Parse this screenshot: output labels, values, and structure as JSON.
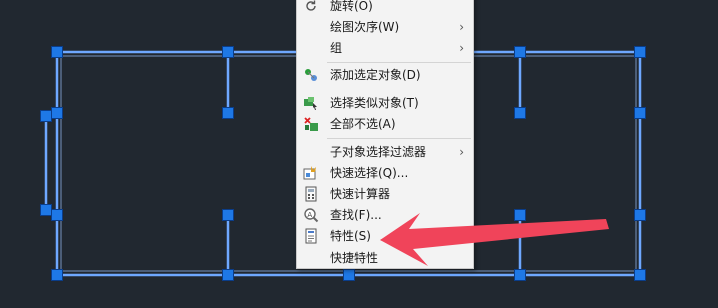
{
  "colors": {
    "background": "#212830",
    "selection_line": "#6fa8ff",
    "grip": "#1e78e6",
    "menu_bg": "#f3f3f3",
    "arrow": "#f0445a"
  },
  "context_menu": {
    "items": [
      {
        "label": "旋转(O)",
        "icon": "rotate-icon",
        "submenu": false
      },
      {
        "label": "绘图次序(W)",
        "icon": "",
        "submenu": true
      },
      {
        "label": "组",
        "icon": "",
        "submenu": true
      },
      {
        "label": "添加选定对象(D)",
        "icon": "add-selected-icon",
        "submenu": false
      },
      {
        "label": "选择类似对象(T)",
        "icon": "select-similar-icon",
        "submenu": false
      },
      {
        "label": "全部不选(A)",
        "icon": "deselect-all-icon",
        "submenu": false
      },
      {
        "label": "子对象选择过滤器",
        "icon": "",
        "submenu": true
      },
      {
        "label": "快速选择(Q)...",
        "icon": "quick-select-icon",
        "submenu": false
      },
      {
        "label": "快速计算器",
        "icon": "calculator-icon",
        "submenu": false
      },
      {
        "label": "查找(F)...",
        "icon": "find-icon",
        "submenu": false
      },
      {
        "label": "特性(S)",
        "icon": "properties-icon",
        "submenu": false
      },
      {
        "label": "快捷特性",
        "icon": "",
        "submenu": false
      }
    ],
    "submenu_arrow": "›"
  }
}
